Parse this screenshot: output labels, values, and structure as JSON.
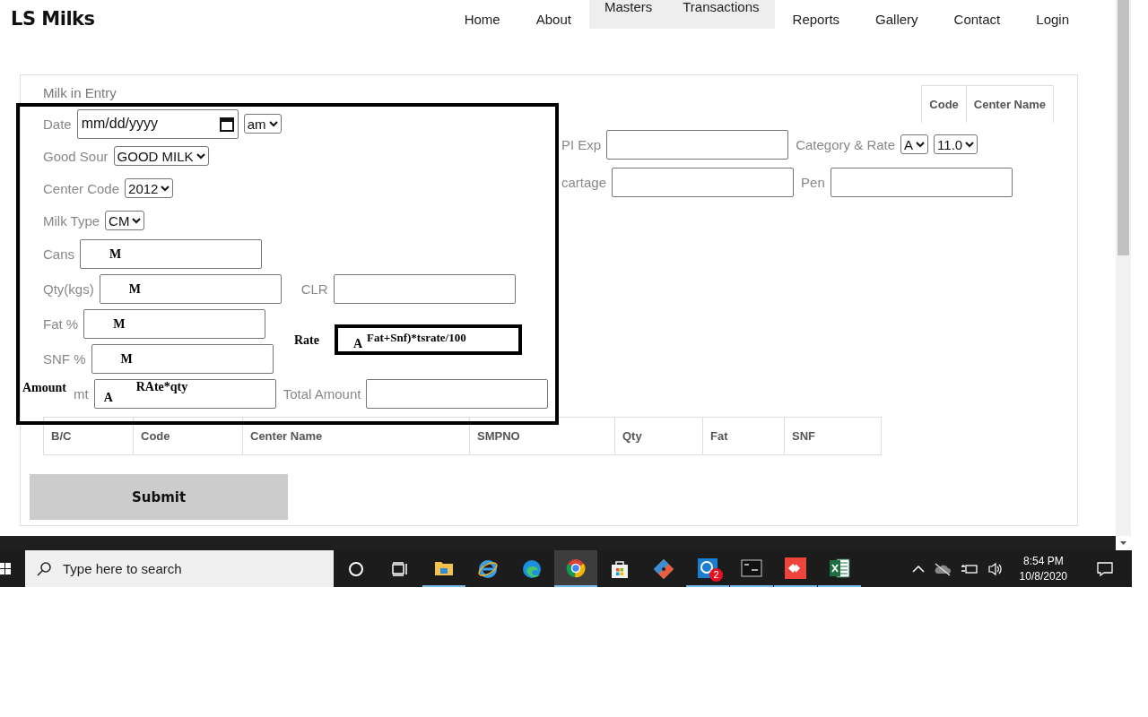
{
  "brand": "LS Milks",
  "nav": [
    {
      "label": "Home",
      "selected": false
    },
    {
      "label": "About",
      "selected": false
    },
    {
      "label": "Masters",
      "selected": true
    },
    {
      "label": "Transactions",
      "selected": true
    },
    {
      "label": "Reports",
      "selected": false
    },
    {
      "label": "Gallery",
      "selected": false
    },
    {
      "label": "Contact",
      "selected": false
    },
    {
      "label": "Login",
      "selected": false
    }
  ],
  "form": {
    "title": "Milk in Entry",
    "rows": [
      {
        "kind": "date",
        "label": "Date",
        "placeholder": "mm/dd/yyyy",
        "select": "am"
      },
      {
        "kind": "select",
        "label": "Good Sour",
        "value": "GOOD MILK"
      },
      {
        "kind": "select",
        "label": "Center Code",
        "value": "2012"
      },
      {
        "kind": "select",
        "label": "Milk Type",
        "value": "CM"
      },
      {
        "kind": "input",
        "label": "Cans",
        "note": "M"
      },
      {
        "kind": "input",
        "label": "Qty(kgs)",
        "note": "M",
        "extra_label": "CLR"
      },
      {
        "kind": "input",
        "label": "Fat %",
        "note": "M"
      },
      {
        "kind": "input",
        "label": "SNF %",
        "note": "M"
      },
      {
        "kind": "input",
        "label": "mt",
        "note": "A",
        "formula": "RAte*qty",
        "annotation": "Amount",
        "extra_label": "Total Amount"
      }
    ],
    "right_table": [
      "Code",
      "Center Name"
    ],
    "right_rows": [
      {
        "kind": "selects",
        "label": "PI Exp",
        "extra_label": "Category & Rate",
        "selects": [
          "A",
          "11.0"
        ]
      },
      {
        "kind": "input",
        "label": "cartage",
        "extra_label": "Pen"
      }
    ],
    "rate_note": {
      "label": "Rate",
      "marker": "A",
      "formula": "Fat+Snf)*tsrate/100"
    },
    "table": {
      "columns": [
        "B/C",
        "Code",
        "Center Name",
        "SMPNO",
        "Qty",
        "Fat",
        "SNF"
      ]
    },
    "submit": "Submit"
  },
  "taskbar": {
    "search_placeholder": "Type here to search",
    "apps": [
      {
        "kind": "cortana",
        "running": false,
        "selected": false
      },
      {
        "kind": "taskview",
        "running": false,
        "selected": false
      },
      {
        "kind": "folder",
        "running": true,
        "selected": false
      },
      {
        "kind": "ie",
        "running": false,
        "selected": false
      },
      {
        "kind": "edge",
        "running": false,
        "selected": false
      },
      {
        "kind": "chrome",
        "running": true,
        "selected": true
      },
      {
        "kind": "store",
        "running": false,
        "selected": false
      },
      {
        "kind": "git",
        "running": false,
        "selected": false
      },
      {
        "kind": "whatsapp",
        "running": true,
        "selected": false,
        "badge": "2"
      },
      {
        "kind": "terminal",
        "running": true,
        "selected": false
      },
      {
        "kind": "anydesk",
        "running": true,
        "selected": false
      },
      {
        "kind": "excel",
        "running": true,
        "selected": false
      }
    ],
    "time": "8:54 PM",
    "date": "10/8/2020"
  }
}
